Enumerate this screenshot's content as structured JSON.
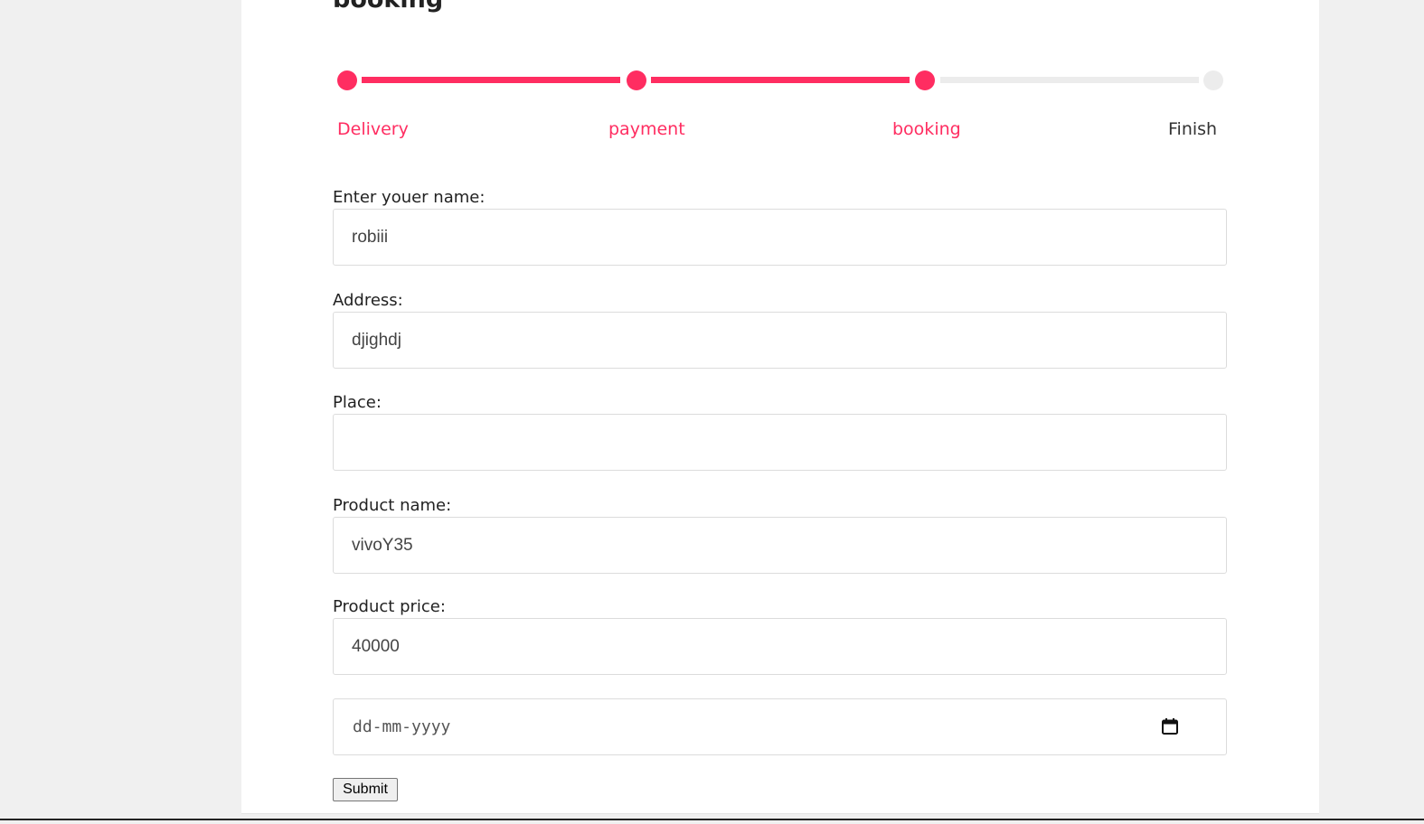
{
  "page": {
    "title": "booking"
  },
  "progress": {
    "steps": [
      {
        "label": "Delivery",
        "active": true
      },
      {
        "label": "payment",
        "active": true
      },
      {
        "label": "booking",
        "active": true
      },
      {
        "label": "Finish",
        "active": false
      }
    ],
    "completed_steps": 3,
    "total_steps": 4
  },
  "form": {
    "name": {
      "label": "Enter youer name:",
      "value": "robiii"
    },
    "address": {
      "label": "Address:",
      "value": "djighdj"
    },
    "place": {
      "label": "Place:",
      "value": ""
    },
    "product_name": {
      "label": "Product name:",
      "value": "vivoY35"
    },
    "product_price": {
      "label": "Product price:",
      "value": "40000"
    },
    "date": {
      "placeholder": "dd-mm-yyyy"
    },
    "submit_label": "Submit"
  },
  "colors": {
    "accent": "#ff2d61",
    "inactive": "#ececec",
    "background": "#f0f0f0"
  },
  "icons": {
    "calendar": "calendar-icon"
  }
}
